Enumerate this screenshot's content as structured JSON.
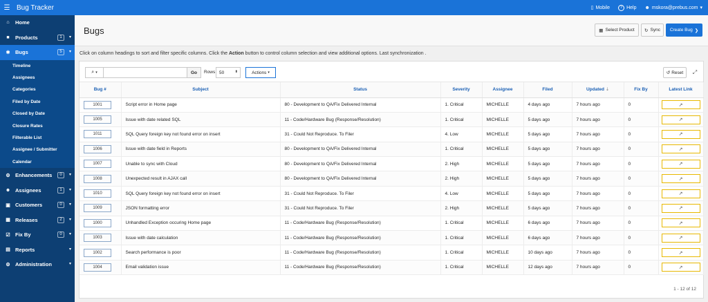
{
  "topbar": {
    "title": "Bug Tracker",
    "mobile": "Mobile",
    "help": "Help",
    "user": "mskora@prebus.com"
  },
  "sidebar": {
    "items": [
      {
        "label": "Home",
        "icon": "home-icon",
        "glyph": "⌂"
      },
      {
        "label": "Products",
        "badge": "1",
        "icon": "box-icon",
        "glyph": "■"
      },
      {
        "label": "Bugs",
        "badge": "5",
        "icon": "bug-icon",
        "glyph": "✱"
      },
      {
        "label": "Enhancements",
        "badge": "0",
        "icon": "gear-icon",
        "glyph": "⚙"
      },
      {
        "label": "Assignees",
        "badge": "1",
        "icon": "users-icon",
        "glyph": "☻"
      },
      {
        "label": "Customers",
        "badge": "0",
        "icon": "customer-icon",
        "glyph": "▣"
      },
      {
        "label": "Releases",
        "badge": "2",
        "icon": "calendar-icon",
        "glyph": "▦"
      },
      {
        "label": "Fix By",
        "badge": "0",
        "icon": "checkbox-icon",
        "glyph": "☑"
      },
      {
        "label": "Reports",
        "icon": "reports-icon",
        "glyph": "▤"
      },
      {
        "label": "Administration",
        "icon": "admin-icon",
        "glyph": "⚙"
      }
    ],
    "bugs_sub": [
      "Timeline",
      "Assignees",
      "Categories",
      "Filed by Date",
      "Closed by Date",
      "Closure Rates",
      "Filterable List",
      "Assignee / Submitter",
      "Calendar"
    ]
  },
  "page": {
    "title": "Bugs",
    "select_product": "Select Product",
    "sync": "Sync",
    "create_bug": "Create Bug",
    "help_pre": "Click on column headings to sort and filter specific columns. Click the ",
    "help_bold": "Action",
    "help_post": " button to control column selection and view additional options. Last synchronization ."
  },
  "toolbar": {
    "search_value": "",
    "go": "Go",
    "rows_label": "Rows",
    "rows_value": "50",
    "actions": "Actions",
    "reset": "Reset"
  },
  "table": {
    "headers": [
      "Bug #",
      "Subject",
      "Status",
      "Severity",
      "Assignee",
      "Filed",
      "Updated",
      "Fix By",
      "Latest Link"
    ],
    "rows": [
      [
        "1001",
        "Script error in Home page",
        "80 - Development to QA/Fix Delivered Internal",
        "1. Critical",
        "MICHELLE",
        "4 days ago",
        "7 hours ago",
        "0"
      ],
      [
        "1005",
        "Issue with date related SQL",
        "11 - Code/Hardware Bug (Response/Resolution)",
        "1. Critical",
        "MICHELLE",
        "5 days ago",
        "7 hours ago",
        "0"
      ],
      [
        "1011",
        "SQL Query foreign key not found error on insert",
        "31 - Could Not Reproduce. To Filer",
        "4. Low",
        "MICHELLE",
        "5 days ago",
        "7 hours ago",
        "0"
      ],
      [
        "1006",
        "Issue with date field in Reports",
        "80 - Development to QA/Fix Delivered Internal",
        "1. Critical",
        "MICHELLE",
        "5 days ago",
        "7 hours ago",
        "0"
      ],
      [
        "1007",
        "Unable to sync with Cloud",
        "80 - Development to QA/Fix Delivered Internal",
        "2. High",
        "MICHELLE",
        "5 days ago",
        "7 hours ago",
        "0"
      ],
      [
        "1008",
        "Unexpected result in AJAX call",
        "80 - Development to QA/Fix Delivered Internal",
        "2. High",
        "MICHELLE",
        "5 days ago",
        "7 hours ago",
        "0"
      ],
      [
        "1010",
        "SQL Query foreign key not found error on insert",
        "31 - Could Not Reproduce. To Filer",
        "4. Low",
        "MICHELLE",
        "5 days ago",
        "7 hours ago",
        "0"
      ],
      [
        "1009",
        "JSON formatting error",
        "31 - Could Not Reproduce. To Filer",
        "2. High",
        "MICHELLE",
        "5 days ago",
        "7 hours ago",
        "0"
      ],
      [
        "1000",
        "Unhandled Exception occuring Home page",
        "11 - Code/Hardware Bug (Response/Resolution)",
        "1. Critical",
        "MICHELLE",
        "6 days ago",
        "7 hours ago",
        "0"
      ],
      [
        "1003",
        "Issue with date calculation",
        "11 - Code/Hardware Bug (Response/Resolution)",
        "1. Critical",
        "MICHELLE",
        "6 days ago",
        "7 hours ago",
        "0"
      ],
      [
        "1002",
        "Search performance is poor",
        "11 - Code/Hardware Bug (Response/Resolution)",
        "1. Critical",
        "MICHELLE",
        "10 days ago",
        "7 hours ago",
        "0"
      ],
      [
        "1004",
        "Email validation issue",
        "11 - Code/Hardware Bug (Response/Resolution)",
        "1. Critical",
        "MICHELLE",
        "12 days ago",
        "7 hours ago",
        "0"
      ]
    ],
    "pagination": "1 - 12 of 12"
  }
}
